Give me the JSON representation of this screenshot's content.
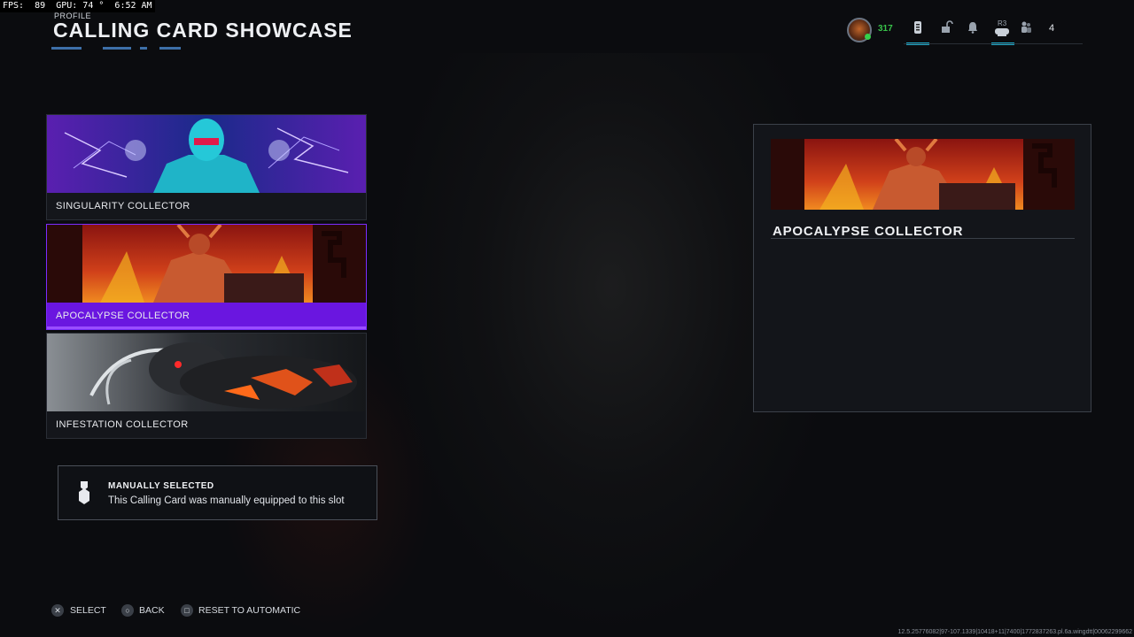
{
  "overlay": {
    "fps_text": "FPS:  89  GPU: 74 °  6:52 AM"
  },
  "header": {
    "breadcrumb": "PROFILE",
    "title": "CALLING CARD SHOWCASE"
  },
  "topbar": {
    "level": "317",
    "r3_label": "R3",
    "count": "4",
    "icons": [
      "player-avatar",
      "battlepass-icon",
      "lock-icon",
      "bell-icon",
      "controller-icon",
      "party-icon"
    ],
    "accent": "#1ea9c9"
  },
  "cards": [
    {
      "label": "SINGULARITY COLLECTOR",
      "selected": false
    },
    {
      "label": "APOCALYPSE COLLECTOR",
      "selected": true
    },
    {
      "label": "INFESTATION COLLECTOR",
      "selected": false
    }
  ],
  "info": {
    "title": "MANUALLY SELECTED",
    "description": "This Calling Card was manually equipped to this slot"
  },
  "detail": {
    "title": "APOCALYPSE COLLECTOR"
  },
  "prompts": [
    {
      "glyph": "cross",
      "label": "SELECT"
    },
    {
      "glyph": "circle",
      "label": "BACK"
    },
    {
      "glyph": "square",
      "label": "RESET TO AUTOMATIC"
    }
  ],
  "build_string": "12.5.25776082|97-107.1339|10418+11|7400|1772837263.pl.6a.wingdtt|00062299662",
  "colors": {
    "selection": "#6a16e0",
    "background": "#0b0c0f",
    "level": "#38c24a"
  }
}
